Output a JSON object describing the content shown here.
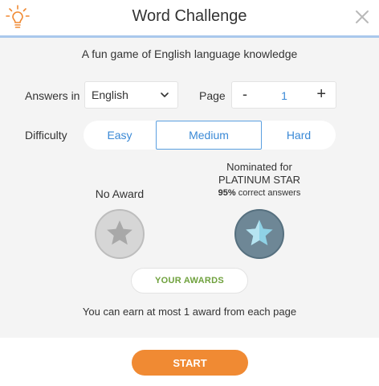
{
  "header": {
    "title": "Word Challenge",
    "logo_icon": "lightbulb-icon",
    "close_icon": "close-icon"
  },
  "subtitle": "A fun game of English language knowledge",
  "answers": {
    "label": "Answers in",
    "selected": "English",
    "icon": "chevron-down-icon"
  },
  "page": {
    "label": "Page",
    "minus": "-",
    "value": "1",
    "plus": "+"
  },
  "difficulty": {
    "label": "Difficulty",
    "options": [
      "Easy",
      "Medium",
      "Hard"
    ],
    "selected": "Medium"
  },
  "awards": {
    "current": {
      "label": "No Award",
      "icon": "star-icon",
      "color": "#d6d6d6"
    },
    "nominated": {
      "line1": "Nominated for",
      "line2": "PLATINUM STAR",
      "percent": "95%",
      "percent_suffix": " correct answers",
      "icon": "star-icon",
      "color": "#6e8796"
    }
  },
  "buttons": {
    "your_awards": "YOUR AWARDS",
    "start": "START"
  },
  "note": "You can earn at most 1 award from each page",
  "colors": {
    "accent_blue": "#3a89d6",
    "start_orange": "#f08a33",
    "awards_green": "#6fa13d",
    "header_rule": "#a9c8ec"
  }
}
